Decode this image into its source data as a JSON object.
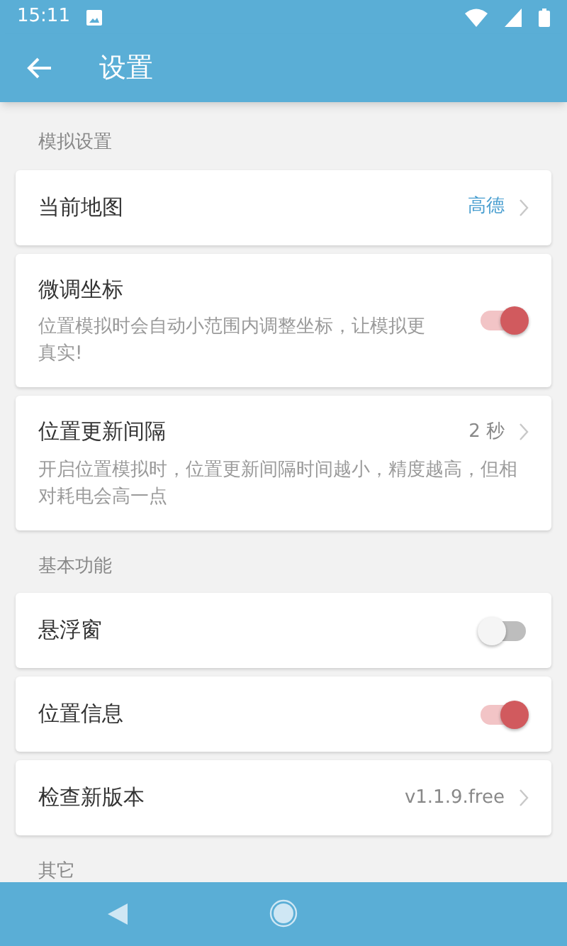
{
  "status_bar": {
    "time": "15:11"
  },
  "app_bar": {
    "title": "设置"
  },
  "sections": [
    {
      "title": "模拟设置",
      "items": [
        {
          "kind": "link",
          "label": "当前地图",
          "value": "高德",
          "accent": true
        },
        {
          "kind": "toggle",
          "label": "微调坐标",
          "description": "位置模拟时会自动小范围内调整坐标，让模拟更真实!",
          "on": true
        },
        {
          "kind": "link",
          "label": "位置更新间隔",
          "value": "2 秒",
          "accent": false,
          "description": "开启位置模拟时，位置更新间隔时间越小，精度越高，但相对耗电会高一点"
        }
      ]
    },
    {
      "title": "基本功能",
      "items": [
        {
          "kind": "toggle",
          "label": "悬浮窗",
          "on": false
        },
        {
          "kind": "toggle",
          "label": "位置信息",
          "on": true
        },
        {
          "kind": "link",
          "label": "检查新版本",
          "value": "v1.1.9.free",
          "accent": false
        }
      ]
    },
    {
      "title": "其它"
    }
  ]
}
